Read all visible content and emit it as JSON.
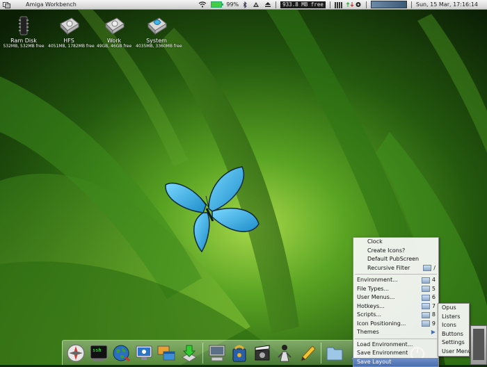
{
  "titlebar": {
    "title": "Amiga Workbench",
    "battery_percent": "99%",
    "free_memory": "933.8 MB free",
    "datetime": "Sun, 15 Mar, 17:16:14",
    "icons": [
      "wifi-icon",
      "battery-icon",
      "bluetooth-icon",
      "screen-icon",
      "eject-icon",
      "cpu-bars-icon",
      "network-icon",
      "volume-icon"
    ]
  },
  "desktop_icons": [
    {
      "name": "Ram Disk",
      "info": "532MB, 532MB free"
    },
    {
      "name": "HFS",
      "info": "4051MB, 1782MB free"
    },
    {
      "name": "Work",
      "info": "49GB, 46GB free"
    },
    {
      "name": "System",
      "info": "4035MB, 3360MB free"
    }
  ],
  "menu": {
    "items_top": [
      "Clock",
      "Create Icons?",
      "Default PubScreen"
    ],
    "recursive_filter": {
      "label": "Recursive Filter",
      "key": "/"
    },
    "items_mid": [
      {
        "label": "Environment...",
        "key": "4"
      },
      {
        "label": "File Types...",
        "key": "5"
      },
      {
        "label": "User Menus...",
        "key": "6"
      },
      {
        "label": "Hotkeys...",
        "key": "7"
      },
      {
        "label": "Scripts...",
        "key": "8"
      },
      {
        "label": "Icon Positioning...",
        "key": "9"
      }
    ],
    "themes": "Themes",
    "items_bottom": [
      "Load Environment...",
      "Save Environment",
      "Save Layout"
    ]
  },
  "submenu": {
    "items": [
      "Opus",
      "Listers",
      "Icons",
      "Buttons",
      "Settings",
      "User Menu"
    ]
  },
  "dock": {
    "icons": [
      "compass-icon",
      "terminal-icon",
      "globe-icon",
      "monitor-icon",
      "windows-icon",
      "download-icon",
      "computer-icon",
      "backup-icon",
      "movie-icon",
      "person-icon",
      "pencil-icon",
      "folder-icon",
      "clock-icon"
    ],
    "terminal_text": "ssh"
  },
  "colors": {
    "accent": "#4a6eae",
    "butterfly": "#3fb7e8",
    "wallpaper": "#3c8a1c"
  }
}
